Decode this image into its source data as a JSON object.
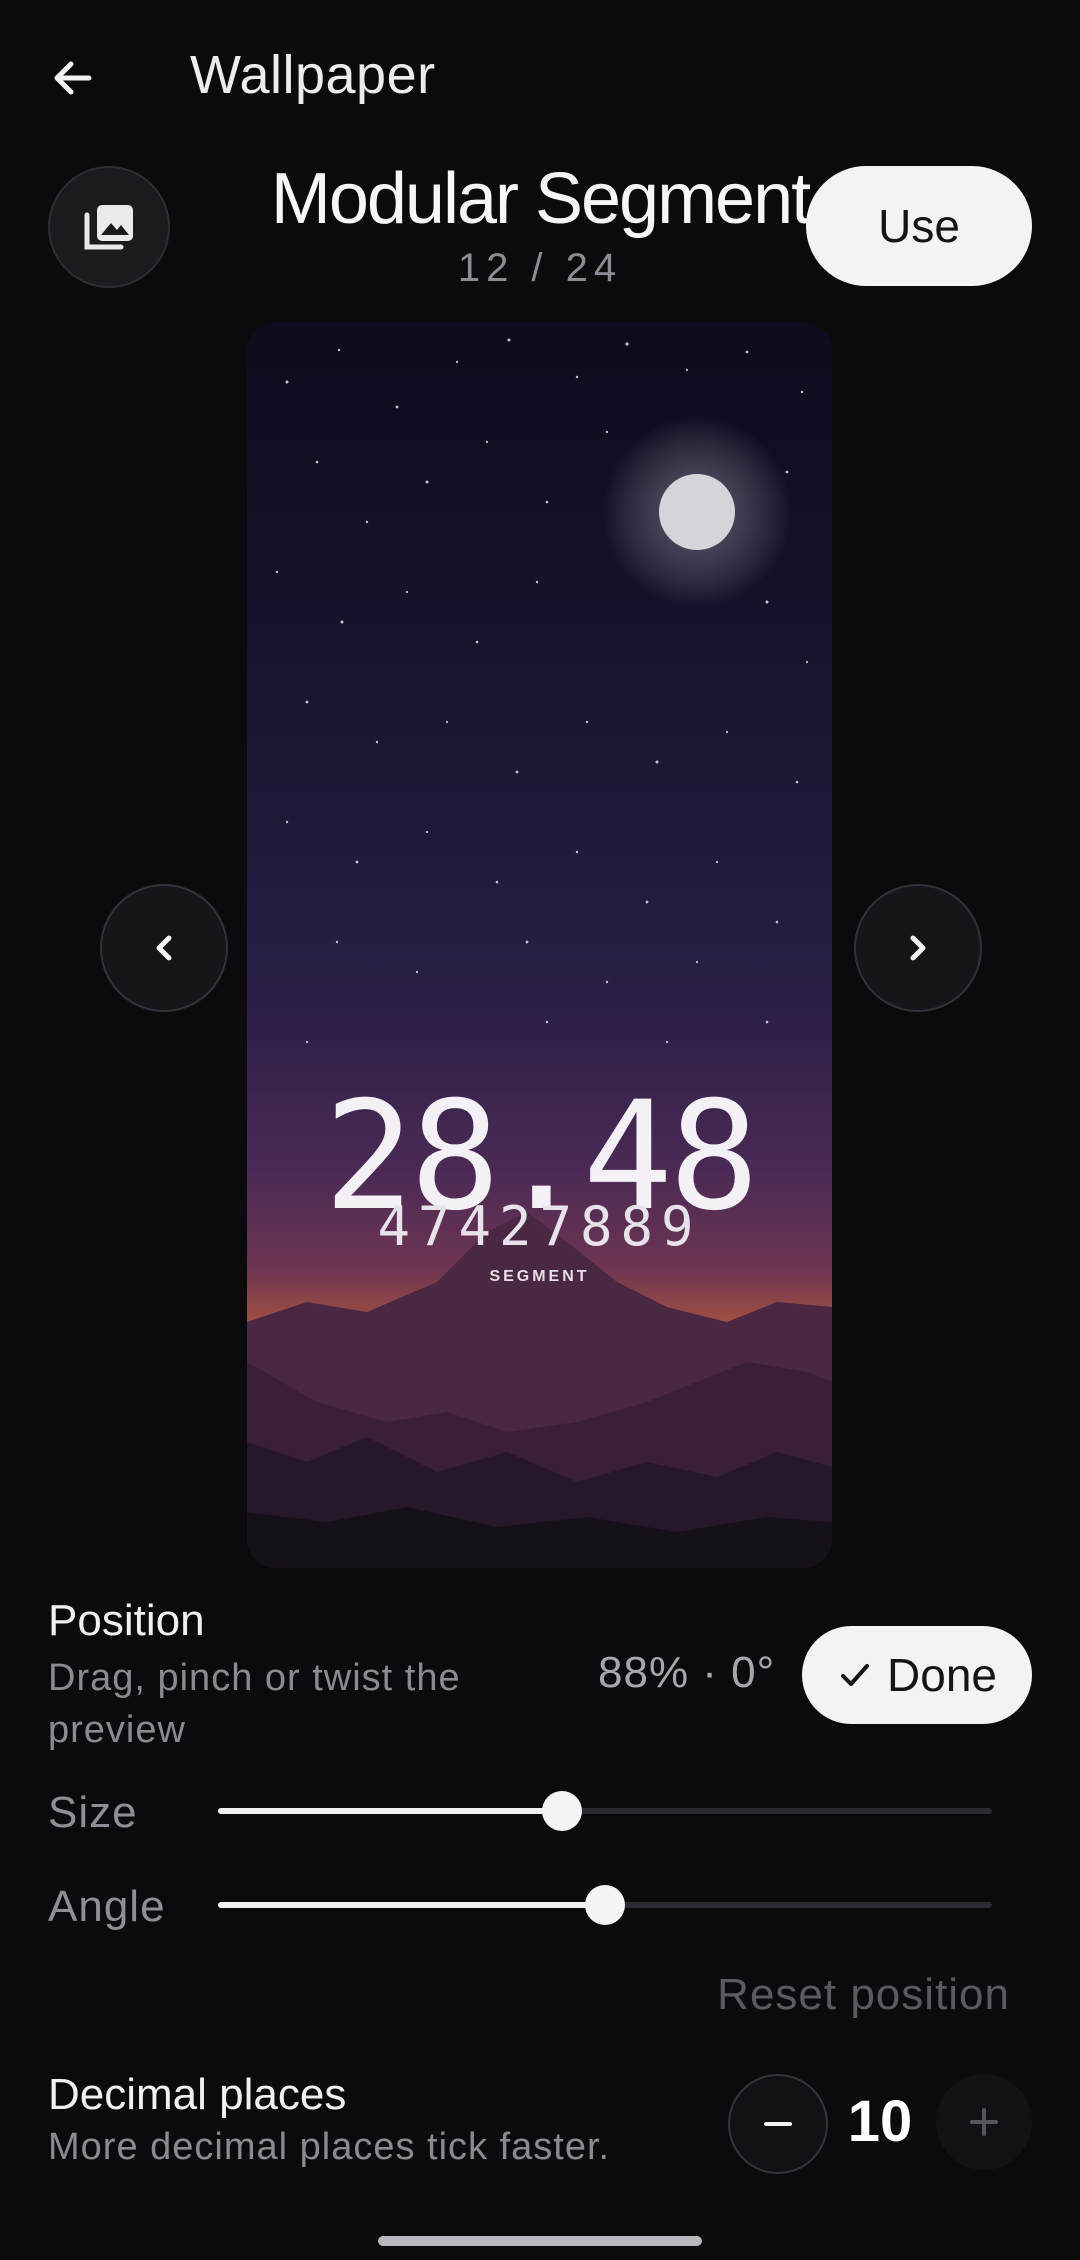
{
  "header": {
    "title": "Wallpaper",
    "back_icon": "arrow-left-icon"
  },
  "wallpaper": {
    "name": "Modular Segment",
    "counter": "12 / 24"
  },
  "actions": {
    "use_label": "Use",
    "gallery_icon": "photo-library-icon"
  },
  "preview": {
    "clock_time": "28.48",
    "clock_digits": "47427889",
    "clock_label": "SEGMENT",
    "prev_icon": "chevron-left-icon",
    "next_icon": "chevron-right-icon"
  },
  "position": {
    "title": "Position",
    "hint": "Drag, pinch or twist the preview",
    "readout": "88% · 0°",
    "done_label": "Done"
  },
  "sliders": {
    "size": {
      "label": "Size",
      "fraction": 0.445
    },
    "angle": {
      "label": "Angle",
      "fraction": 0.5
    }
  },
  "reset_label": "Reset position",
  "decimal": {
    "title": "Decimal places",
    "hint": "More decimal places tick faster.",
    "value": "10"
  },
  "colors": {
    "accent": "#f3f3f5",
    "background": "#0b0b0d",
    "muted": "#8a8a92"
  }
}
